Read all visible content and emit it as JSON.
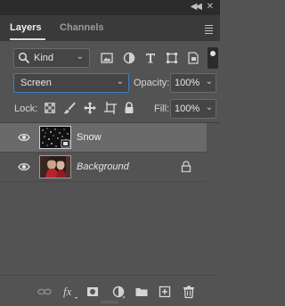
{
  "tabs": [
    {
      "label": "Layers",
      "active": true
    },
    {
      "label": "Channels",
      "active": false
    }
  ],
  "filter": {
    "kind_label": "Kind",
    "icons": [
      "image-filter-icon",
      "adjustment-filter-icon",
      "type-filter-icon",
      "shape-filter-icon",
      "smart-object-filter-icon"
    ]
  },
  "blend": {
    "mode": "Screen",
    "opacity_label": "Opacity:",
    "opacity_value": "100%"
  },
  "lock": {
    "label": "Lock:",
    "fill_label": "Fill:",
    "fill_value": "100%"
  },
  "layers": [
    {
      "name": "Snow",
      "visible": true,
      "selected": true,
      "locked": false
    },
    {
      "name": "Background",
      "visible": true,
      "selected": false,
      "locked": true
    }
  ],
  "footer_icons": [
    "link-layers-icon",
    "fx-icon",
    "add-mask-icon",
    "adjustment-layer-icon",
    "new-group-icon",
    "new-layer-icon",
    "delete-layer-icon"
  ],
  "colors": {
    "panel_bg": "#535353",
    "selected_row": "#6a6a6a",
    "focus_border": "#3d7fc0"
  }
}
